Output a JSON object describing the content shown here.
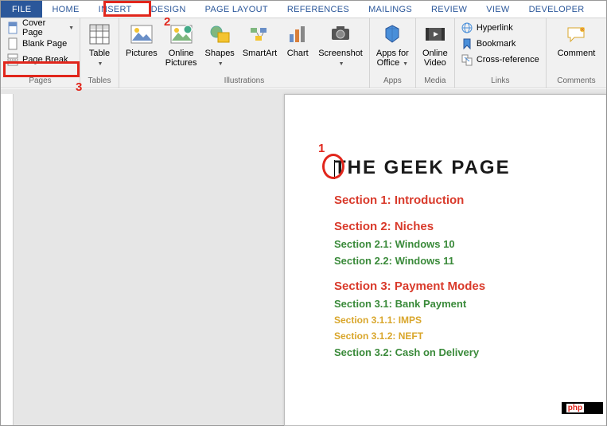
{
  "tabs": {
    "file": "FILE",
    "home": "HOME",
    "insert": "INSERT",
    "design": "DESIGN",
    "page_layout": "PAGE LAYOUT",
    "references": "REFERENCES",
    "mailings": "MAILINGS",
    "review": "REVIEW",
    "view": "VIEW",
    "developer": "DEVELOPER"
  },
  "ribbon": {
    "pages": {
      "label": "Pages",
      "cover_page": "Cover Page",
      "blank_page": "Blank Page",
      "page_break": "Page Break"
    },
    "tables": {
      "label": "Tables",
      "table": "Table"
    },
    "illustrations": {
      "label": "Illustrations",
      "pictures": "Pictures",
      "online_pictures": "Online\nPictures",
      "shapes": "Shapes",
      "smartart": "SmartArt",
      "chart": "Chart",
      "screenshot": "Screenshot"
    },
    "apps": {
      "label": "Apps",
      "apps_for_office": "Apps for\nOffice"
    },
    "media": {
      "label": "Media",
      "online_video": "Online\nVideo"
    },
    "links": {
      "label": "Links",
      "hyperlink": "Hyperlink",
      "bookmark": "Bookmark",
      "cross_reference": "Cross-reference"
    },
    "comments": {
      "label": "Comments",
      "comment": "Comment"
    }
  },
  "document": {
    "title": "THE GEEK PAGE",
    "sections": [
      {
        "text": "Section 1: Introduction",
        "cls": "sec red"
      },
      {
        "text": "",
        "cls": "gap"
      },
      {
        "text": "Section 2: Niches",
        "cls": "sec red"
      },
      {
        "text": "Section 2.1: Windows 10",
        "cls": "sec green"
      },
      {
        "text": "Section 2.2: Windows 11",
        "cls": "sec green"
      },
      {
        "text": "",
        "cls": "gap"
      },
      {
        "text": "Section 3: Payment Modes",
        "cls": "sec red"
      },
      {
        "text": "Section 3.1: Bank Payment",
        "cls": "sec green"
      },
      {
        "text": "Section 3.1.1: IMPS",
        "cls": "sec orange"
      },
      {
        "text": "Section 3.1.2: NEFT",
        "cls": "sec orange"
      },
      {
        "text": "Section 3.2: Cash on Delivery",
        "cls": "sec green"
      }
    ]
  },
  "annotations": {
    "n1": "1",
    "n2": "2",
    "n3": "3"
  },
  "watermark": {
    "p": "php",
    "rest": ""
  }
}
